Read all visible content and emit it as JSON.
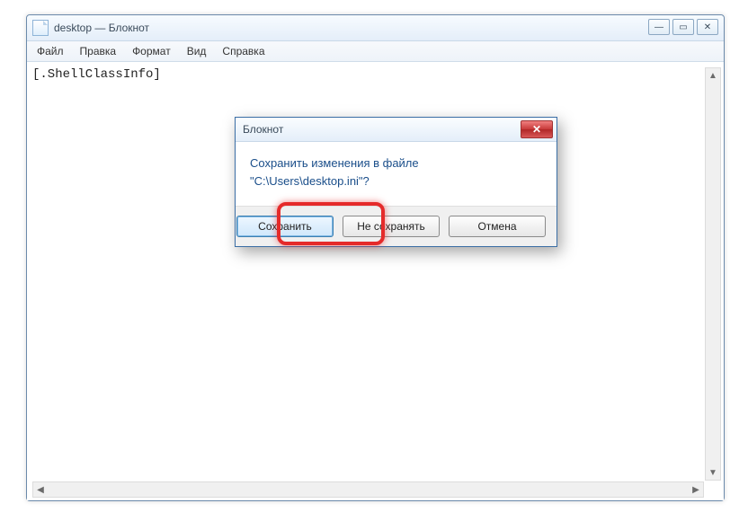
{
  "window": {
    "title": "desktop — Блокнот"
  },
  "menu": {
    "file": "Файл",
    "edit": "Правка",
    "format": "Формат",
    "view": "Вид",
    "help": "Справка"
  },
  "editor": {
    "content": "[.ShellClassInfo]"
  },
  "dialog": {
    "title": "Блокнот",
    "message_line1": "Сохранить изменения в файле",
    "message_line2": "\"C:\\Users\\desktop.ini\"?",
    "save": "Сохранить",
    "dont_save": "Не сохранять",
    "cancel": "Отмена"
  }
}
